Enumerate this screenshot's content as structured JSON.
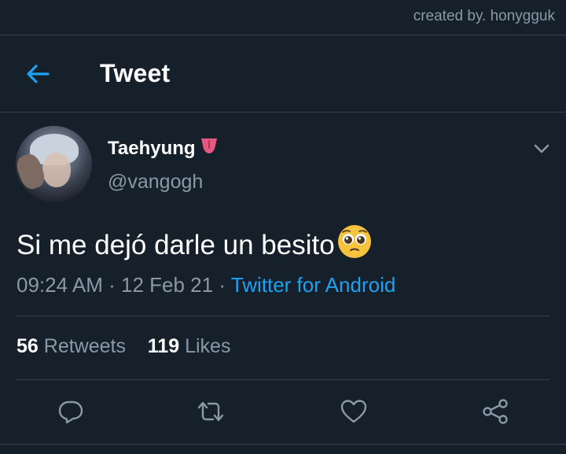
{
  "credit": "created by. honygguk",
  "header": {
    "title": "Tweet",
    "back_icon": "arrow-left-icon"
  },
  "tweet": {
    "display_name": "Taehyung",
    "name_emoji": "tongue-icon",
    "handle": "@vangogh",
    "text": "Si me dejó darle un besito",
    "text_emoji": "pleading-face-icon",
    "time": "09:24 AM",
    "separator": "·",
    "date": "12 Feb 21",
    "source": "Twitter for Android",
    "retweets": "56",
    "retweets_label": "Retweets",
    "likes": "119",
    "likes_label": "Likes"
  },
  "actions": [
    "reply-icon",
    "retweet-icon",
    "like-icon",
    "share-icon"
  ],
  "colors": {
    "background": "#15202b",
    "divider": "#38444d",
    "accent": "#1da1f2",
    "muted": "#8b98a5",
    "text": "#ffffff"
  }
}
